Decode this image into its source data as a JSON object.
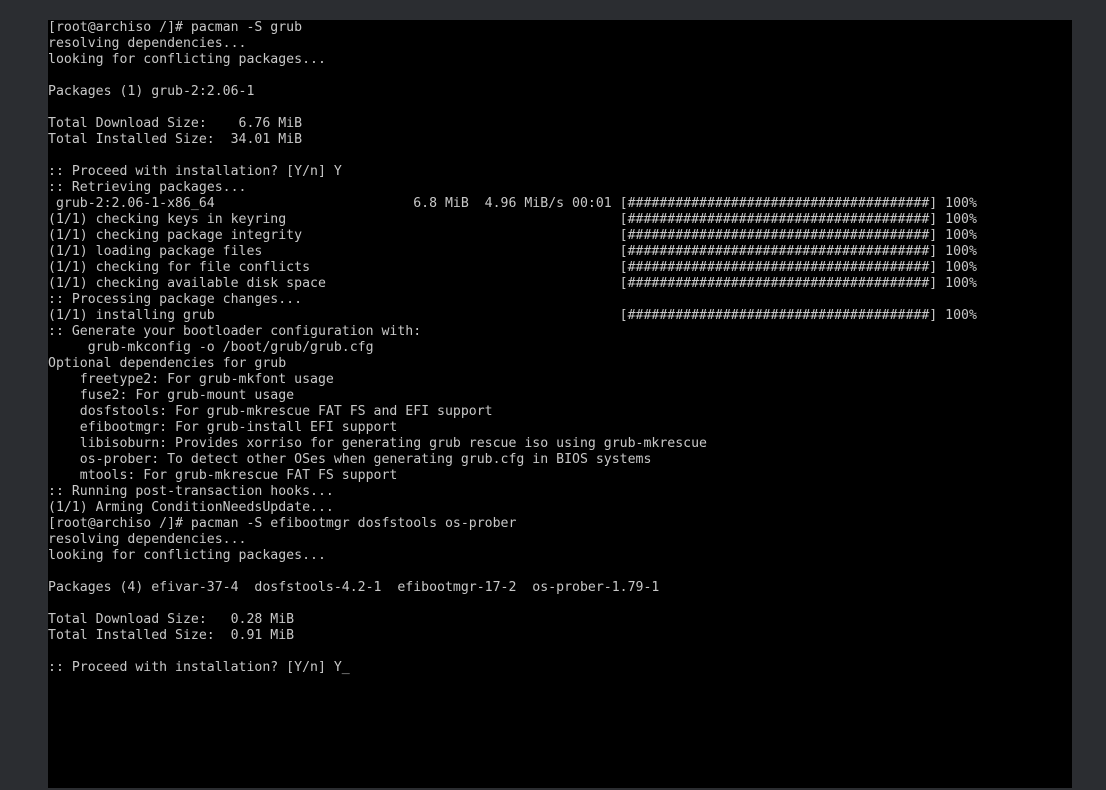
{
  "terminal": {
    "lines": [
      "[root@archiso /]# pacman -S grub",
      "resolving dependencies...",
      "looking for conflicting packages...",
      "",
      "Packages (1) grub-2:2.06-1",
      "",
      "Total Download Size:    6.76 MiB",
      "Total Installed Size:  34.01 MiB",
      "",
      ":: Proceed with installation? [Y/n] Y",
      ":: Retrieving packages...",
      " grub-2:2.06-1-x86_64                         6.8 MiB  4.96 MiB/s 00:01 [######################################] 100%",
      "(1/1) checking keys in keyring                                          [######################################] 100%",
      "(1/1) checking package integrity                                        [######################################] 100%",
      "(1/1) loading package files                                             [######################################] 100%",
      "(1/1) checking for file conflicts                                       [######################################] 100%",
      "(1/1) checking available disk space                                     [######################################] 100%",
      ":: Processing package changes...",
      "(1/1) installing grub                                                   [######################################] 100%",
      ":: Generate your bootloader configuration with:",
      "     grub-mkconfig -o /boot/grub/grub.cfg",
      "Optional dependencies for grub",
      "    freetype2: For grub-mkfont usage",
      "    fuse2: For grub-mount usage",
      "    dosfstools: For grub-mkrescue FAT FS and EFI support",
      "    efibootmgr: For grub-install EFI support",
      "    libisoburn: Provides xorriso for generating grub rescue iso using grub-mkrescue",
      "    os-prober: To detect other OSes when generating grub.cfg in BIOS systems",
      "    mtools: For grub-mkrescue FAT FS support",
      ":: Running post-transaction hooks...",
      "(1/1) Arming ConditionNeedsUpdate...",
      "[root@archiso /]# pacman -S efibootmgr dosfstools os-prober",
      "resolving dependencies...",
      "looking for conflicting packages...",
      "",
      "Packages (4) efivar-37-4  dosfstools-4.2-1  efibootmgr-17-2  os-prober-1.79-1",
      "",
      "Total Download Size:   0.28 MiB",
      "Total Installed Size:  0.91 MiB",
      "",
      ":: Proceed with installation? [Y/n] Y"
    ],
    "cursor": "_",
    "colors": {
      "background": "#000000",
      "foreground": "#c8c8c8",
      "frame": "#2b2d31"
    }
  }
}
